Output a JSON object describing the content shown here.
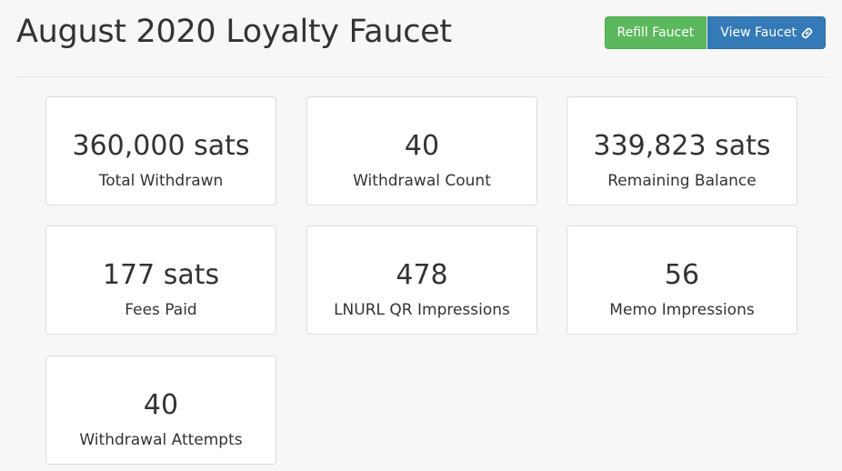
{
  "header": {
    "title": "August 2020 Loyalty Faucet",
    "refill_label": "Refill Faucet",
    "view_label": "View Faucet"
  },
  "stats": [
    {
      "value": "360,000 sats",
      "label": "Total Withdrawn"
    },
    {
      "value": "40",
      "label": "Withdrawal Count"
    },
    {
      "value": "339,823 sats",
      "label": "Remaining Balance"
    },
    {
      "value": "177 sats",
      "label": "Fees Paid"
    },
    {
      "value": "478",
      "label": "LNURL QR Impressions"
    },
    {
      "value": "56",
      "label": "Memo Impressions"
    },
    {
      "value": "40",
      "label": "Withdrawal Attempts"
    }
  ],
  "colors": {
    "refill_button": "#5cb85c",
    "view_button": "#337ab7",
    "background": "#f7f7f7"
  },
  "icons": {
    "view_button_icon": "link-icon"
  }
}
